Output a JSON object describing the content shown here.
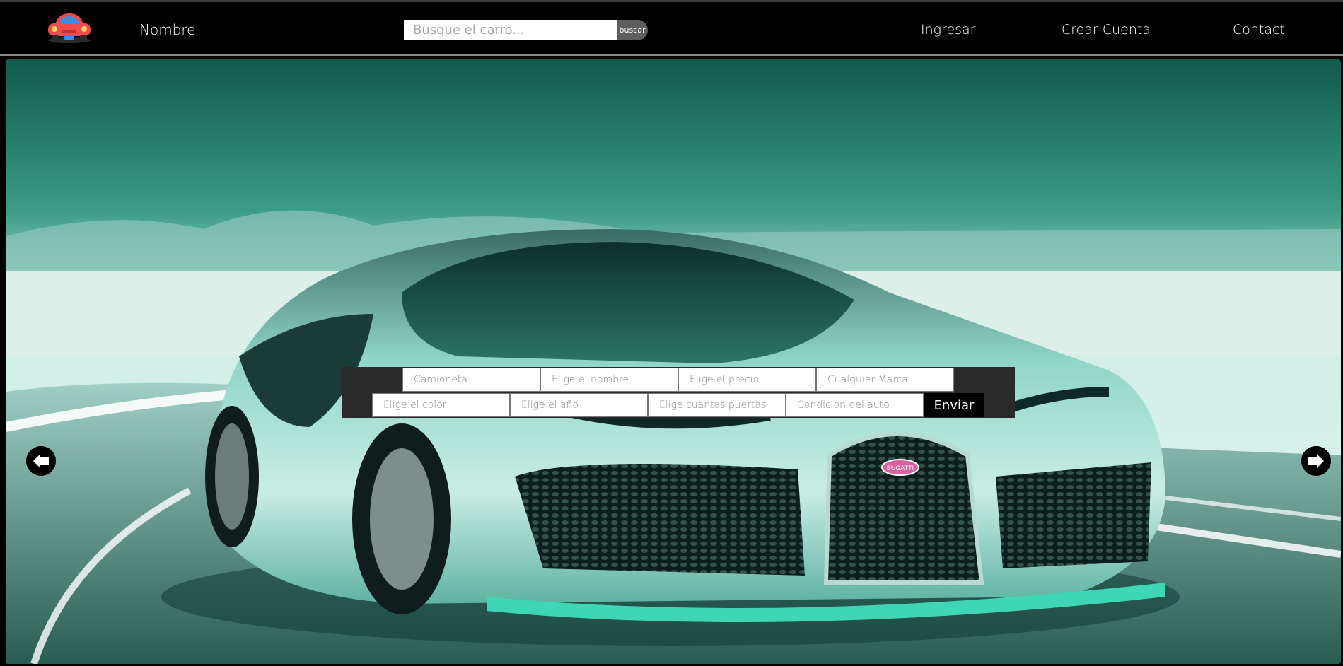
{
  "navbar": {
    "logo_icon": "car-icon",
    "brand": "Nombre",
    "search": {
      "placeholder": "Busque el carro...",
      "button_label": "buscar"
    },
    "links": {
      "login": "Ingresar",
      "signup": "Crear Cuenta",
      "contact": "Contact"
    }
  },
  "hero": {
    "image": "bugatti-supercar-on-road",
    "badge_text": "BUGATTI",
    "prev_icon": "arrow-left-icon",
    "next_icon": "arrow-right-icon"
  },
  "filters": {
    "tipo": "Camioneta",
    "nombre": "Elige el nombre",
    "precio": "Elige el precio",
    "marca": "Cualquier Marca",
    "color": "Elige el color",
    "anio": "Elige el año",
    "puertas": "Elige cuantas puertas",
    "condicion": "Condicion del auto",
    "submit_label": "Enviar"
  },
  "colors": {
    "navbar_bg": "#000000",
    "accent_teal": "#3fd6b8",
    "car_body": "#7ec9b8",
    "logo_red": "#ef4b4b",
    "logo_blue": "#3b8ee0"
  }
}
